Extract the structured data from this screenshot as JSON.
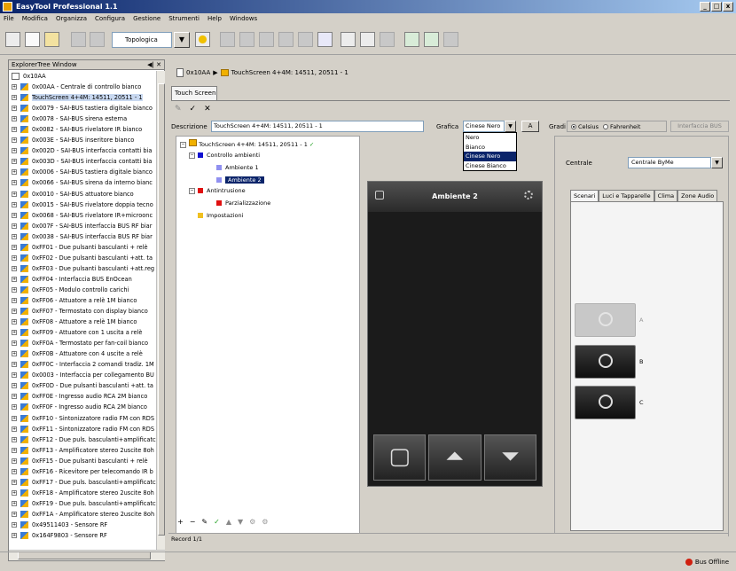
{
  "window": {
    "title": "EasyTool Professional 1.1",
    "min": "_",
    "max": "□",
    "close": "x"
  },
  "menu": [
    "File",
    "Modifica",
    "Organizza",
    "Configura",
    "Gestione",
    "Strumenti",
    "Help",
    "Windows"
  ],
  "toolbar": {
    "view_combo": "Topologica",
    "combo_arrow": "▼"
  },
  "explorer": {
    "title": "ExplorerTree Window",
    "controls": "◀| ✕",
    "items": [
      "0x10AA",
      "0x00AA - Centrale di controllo bianco",
      "TouchScreen 4+4M: 14511, 20511 - 1",
      "0x0079 - SAI-BUS tastiera digitale bianco",
      "0x0078 - SAI-BUS sirena esterna",
      "0x0082 - SAI-BUS rivelatore IR bianco",
      "0x003E - SAI-BUS inseritore bianco",
      "0x002D - SAI-BUS interfaccia contatti bia",
      "0x003D - SAI-BUS interfaccia contatti bia",
      "0x0006 - SAI-BUS tastiera digitale bianco",
      "0x0066 - SAI-BUS sirena da interno bianc",
      "0x0010 - SAI-BUS attuatore bianco",
      "0x0015 - SAI-BUS rivelatore doppia tecno",
      "0x0068 - SAI-BUS rivelatore IR+microonc",
      "0x007F - SAI-BUS interfaccia BUS RF biar",
      "0x0038 - SAI-BUS interfaccia BUS RF biar",
      "0xFF01 - Due pulsanti basculanti + relè",
      "0xFF02 - Due pulsanti basculanti +att. ta",
      "0xFF03 - Due pulsanti basculanti +att.reg",
      "0xFF04 - Interfaccia BUS EnOcean",
      "0xFF05 - Modulo controllo carichi",
      "0xFF06 - Attuatore a relè 1M bianco",
      "0xFF07 - Termostato con display bianco",
      "0xFF08 - Attuatore a relè 1M bianco",
      "0xFF09 - Attuatore con 1 uscita a relè",
      "0xFF0A - Termostato per fan-coil bianco",
      "0xFF0B - Attuatore con 4 uscite a relè",
      "0xFF0C - Interfaccia 2 comandi tradiz. 1M",
      "0x0003 - Interfaccia per collegamento BU",
      "0xFF0D - Due pulsanti basculanti +att. ta",
      "0xFF0E - Ingresso audio RCA 2M bianco",
      "0xFF0F - Ingresso audio RCA 2M bianco",
      "0xFF10 - Sintonizzatore radio FM con RDS",
      "0xFF11 - Sintonizzatore radio FM con RDS",
      "0xFF12 - Due puls. basculanti+amplificatc",
      "0xFF13 - Amplificatore stereo 2uscite 8oh",
      "0xFF15 - Due pulsanti basculanti + relè",
      "0xFF16 - Ricevitore per telecomando IR b",
      "0xFF17 - Due puls. basculanti+amplificatc",
      "0xFF18 - Amplificatore stereo 2uscite 8oh",
      "0xFF19 - Due puls. basculanti+amplificatc",
      "0xFF1A - Amplificatore stereo 2uscite 8oh",
      "0x49511403 - Sensore RF",
      "0x164F9803 - Sensore RF"
    ]
  },
  "breadcrumb": {
    "root": "0x10AA",
    "sep": "▶",
    "current": "TouchScreen 4+4M: 14511, 20511 - 1"
  },
  "tab": "Touch Screen",
  "editbar": [
    "✎",
    "✓",
    "✕"
  ],
  "form": {
    "desc_label": "Descrizione",
    "desc_value": "TouchScreen 4+4M: 14511, 20511 - 1",
    "grafica_label": "Grafica",
    "grafica_value": "Cinese Nero",
    "grafica_arrow": "▼",
    "a_button": "A",
    "gradi_label": "Gradi",
    "celsius": "Celsius",
    "fahrenheit": "Fahrenheit",
    "bus_button": "Interfaccia BUS"
  },
  "grafica_options": [
    "Nero",
    "Bianco",
    "Cinese Nero",
    "Cinese Bianco"
  ],
  "tree": {
    "root": "TouchScreen 4+4M: 14511, 20511 - 1",
    "root_check": "✓",
    "controllo": "Controllo ambienti",
    "amb1": "Ambiente 1",
    "amb2": "Ambiente 2",
    "antintrusione": "Antintrusione",
    "parz": "Parzializzazione",
    "impostazioni": "Impostazioni",
    "tools": [
      "+",
      "−",
      "✎",
      "✓",
      "▲",
      "▼",
      "⚙",
      "⚙"
    ]
  },
  "device": {
    "title": "Ambiente 2",
    "buttons": [
      "▢",
      "⏶",
      "⏷"
    ]
  },
  "right": {
    "centrale_label": "Centrale",
    "centrale_value": "Centrale ByMe",
    "centrale_arrow": "▼",
    "tabs": [
      "Scenari",
      "Luci e Tapparelle",
      "Clima",
      "Zone Audio"
    ],
    "scenes": [
      "A",
      "B",
      "C"
    ]
  },
  "record": "Record 1/1",
  "status": "Bus Offline",
  "colors": {
    "blue_sq": "#1010d0",
    "lightblue_sq": "#9090f0",
    "red_sq": "#e01010",
    "yellow_sq": "#f0c020",
    "check": "#20a020"
  }
}
